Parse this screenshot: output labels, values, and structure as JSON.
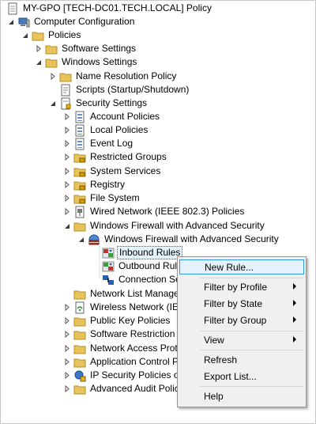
{
  "tree": {
    "root": "MY-GPO [TECH-DC01.TECH.LOCAL] Policy",
    "computer_configuration": "Computer Configuration",
    "policies": "Policies",
    "software_settings": "Software Settings",
    "windows_settings": "Windows Settings",
    "name_resolution_policy": "Name Resolution Policy",
    "scripts": "Scripts (Startup/Shutdown)",
    "security_settings": "Security Settings",
    "account_policies": "Account Policies",
    "local_policies": "Local Policies",
    "event_log": "Event Log",
    "restricted_groups": "Restricted Groups",
    "system_services": "System Services",
    "registry": "Registry",
    "file_system": "File System",
    "wired_network": "Wired Network (IEEE 802.3) Policies",
    "wfas_parent": "Windows Firewall with Advanced Security",
    "wfas_child": "Windows Firewall with Advanced Security",
    "inbound_rules": "Inbound Rules",
    "outbound_rules": "Outbound Rul",
    "connection_security": "Connection Se",
    "network_list_manager": "Network List Manage",
    "wireless_network": "Wireless Network (IEE",
    "public_key_policies": "Public Key Policies",
    "software_restriction": "Software Restriction P",
    "network_access_protection": "Network Access Prote",
    "application_control": "Application Control P",
    "ip_security": "IP Security Policies on",
    "advanced_audit": "Advanced Audit Polic"
  },
  "context_menu": {
    "new_rule": "New Rule...",
    "filter_by_profile": "Filter by Profile",
    "filter_by_state": "Filter by State",
    "filter_by_group": "Filter by Group",
    "view": "View",
    "refresh": "Refresh",
    "export_list": "Export List...",
    "help": "Help"
  },
  "colors": {
    "highlight_border": "#3399dd",
    "highlight_fill": "#e5f1fb",
    "folder": "#e8c25a",
    "menu_bg": "#f0f0f0"
  }
}
